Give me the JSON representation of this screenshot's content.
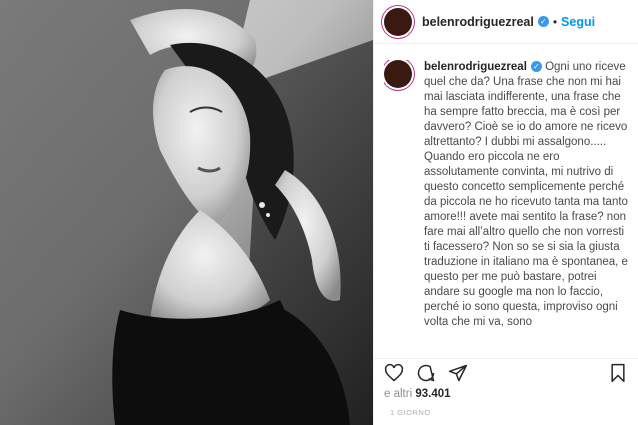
{
  "post": {
    "username": "belenrodriguezreal",
    "follow_label": "Segui",
    "dot": "•"
  },
  "caption": {
    "username": "belenrodriguezreal",
    "text": "Ogni uno riceve quel che da? Una frase che non mi hai mai lasciata indifferente, una frase che ha sempre fatto breccia, ma è così per davvero? Cioè se io do amore ne ricevo altrettanto? I dubbi mi assalgono.....",
    "text2": "Quando ero piccola ne ero assolutamente convinta, mi nutrivo di questo concetto semplicemente perché da piccola ne ho ricevuto tanta ma tanto amore!!! avete mai sentito la frase? non fare mai all’altro quello che non vorresti ti facessero? Non so se si sia la giusta traduzione in italiano ma è spontanea, e questo per me può bastare, potrei andare su google ma non lo faccio, perché io sono questa, improviso ogni volta che mi va, sono"
  },
  "likes": {
    "prefix": "e altri",
    "count": "93.401"
  },
  "time": "1 GIORNO",
  "icons": [
    "heart-icon",
    "comment-icon",
    "share-icon",
    "bookmark-icon"
  ],
  "colors": {
    "accent": "#0095f6",
    "verified": "#3897f0"
  }
}
